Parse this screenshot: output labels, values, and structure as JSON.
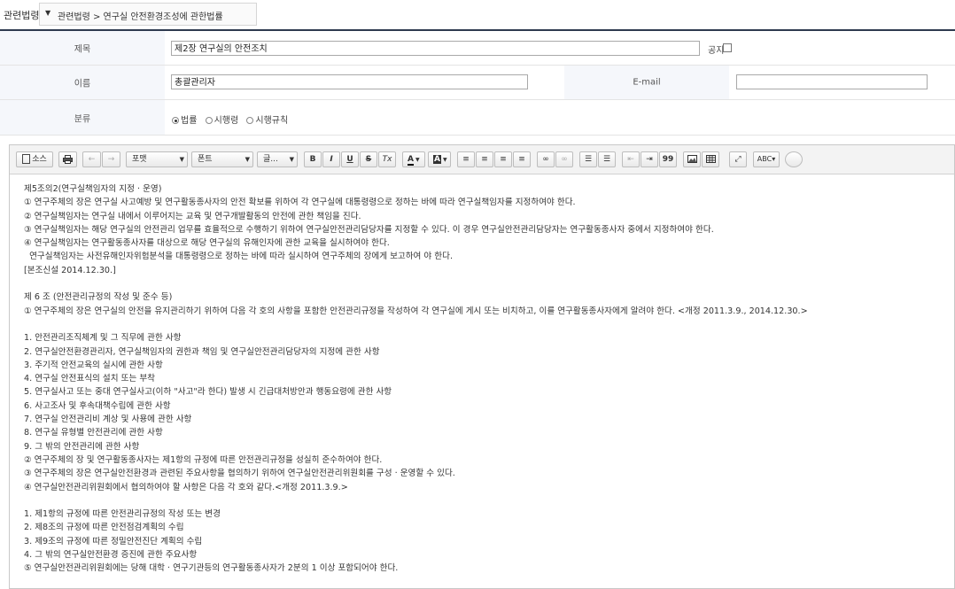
{
  "topbar": {
    "label": "관련법령",
    "arrow_icon": "▼",
    "breadcrumb": "관련법령 > 연구실 안전환경조성에 관한법률"
  },
  "form": {
    "title_label": "제목",
    "title_value": "제2장 연구실의 안전조치",
    "notice_label": "공지",
    "name_label": "이름",
    "name_value": "총괄관리자",
    "email_label": "E-mail",
    "email_value": "",
    "category_label": "분류",
    "category_options": [
      "법률",
      "시행령",
      "시행규칙"
    ],
    "category_selected": "법률"
  },
  "toolbar": {
    "source_label": "소스",
    "format_label": "포맷",
    "font_label": "폰트",
    "size_label": "글...",
    "bold": "B",
    "italic": "I",
    "underline": "U",
    "strike": "S",
    "clear": "Tx",
    "quote": "99",
    "text_color": "A",
    "bg_color": "A"
  },
  "content": {
    "lines": [
      "제5조의2(연구실책임자의 지정 · 운영)",
      "① 연구주체의 장은 연구실 사고예방 및 연구활동종사자의 안전 확보를 위하여 각 연구실에 대통령령으로 정하는 바에 따라 연구실책임자를 지정하여야 한다.",
      "② 연구실책임자는 연구실 내에서 이루어지는 교육 및 연구개발활동의 안전에 관한 책임을 진다.",
      "③ 연구실책임자는 해당 연구실의 안전관리 업무를 효율적으로 수행하기 위하여 연구실안전관리담당자를 지정할 수 있다. 이 경우 연구실안전관리담당자는 연구활동종사자 중에서 지정하여야 한다.",
      "④ 연구실책임자는 연구활동종사자를 대상으로 해당 연구실의 유해인자에 관한 교육을 실시하여야 한다.",
      "  연구실책임자는 사전유해인자위험분석을 대통령령으로 정하는 바에 따라 실시하여 연구주체의 장에게 보고하여 야 한다.",
      "[본조신설 2014.12.30.]",
      "",
      "제 6 조 (안전관리규정의 작성 및 준수 등)",
      "① 연구주체의 장은 연구실의 안전을 유지관리하기 위하여 다음 각 호의 사항을 포함한 안전관리규정을 작성하여 각 연구실에 게시 또는 비치하고, 이를 연구활동종사자에게 알려야 한다. <개정 2011.3.9., 2014.12.30.>",
      "",
      "1. 안전관리조직체계 및 그 직무에 관한 사항",
      "2. 연구실안전환경관리자, 연구실책임자의 권한과 책임 및 연구실안전관리담당자의 지정에 관한 사항",
      "3. 주기적 안전교육의 실시에 관한 사항",
      "4. 연구실 안전표식의 설치 또는 부착",
      "5. 연구실사고 또는 중대 연구실사고(이하 \"사고\"라 한다) 발생 시 긴급대처방안과 행동요령에 관한 사항",
      "6. 사고조사 및 후속대책수립에 관한 사항",
      "7. 연구실 안전관리비 계상 및 사용에 관한 사항",
      "8. 연구실 유형별 안전관리에 관한 사항",
      "9. 그 밖의 안전관리에 관한 사항",
      "② 연구주체의 장 및 연구활동종사자는 제1항의 규정에 따른 안전관리규정을 성실히 준수하여야 한다.",
      "③ 연구주체의 장은 연구실안전환경과 관련된 주요사항을 협의하기 위하여 연구실안전관리위원회를 구성 · 운영할 수 있다.",
      "④ 연구실안전관리위원회에서 협의하여야 할 사항은 다음 각 호와 같다.<개정 2011.3.9.>",
      "",
      "1. 제1항의 규정에 따른 안전관리규정의 작성 또는 변경",
      "2. 제8조의 규정에 따른 안전점검계획의 수립",
      "3. 제9조의 규정에 따른 정밀안전진단 계획의 수립",
      "4. 그 밖의 연구실안전환경 증진에 관한 주요사항",
      "⑤ 연구실안전관리위원회에는 당해 대학 · 연구기관등의 연구활동종사자가 2분의 1 이상 포함되어야 한다."
    ]
  }
}
